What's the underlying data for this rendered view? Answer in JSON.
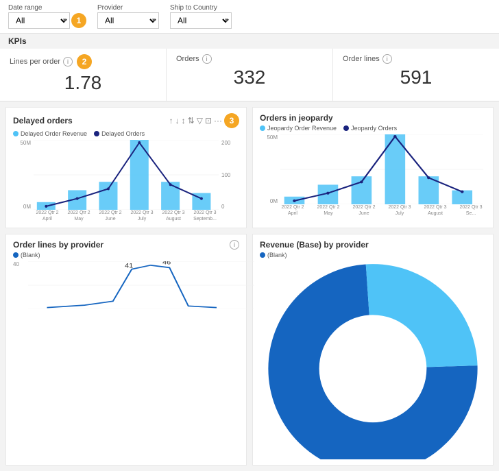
{
  "filters": {
    "date_range": {
      "label": "Date range",
      "value": "All"
    },
    "provider": {
      "label": "Provider",
      "value": "All"
    },
    "ship_to_country": {
      "label": "Ship to Country",
      "value": "All"
    }
  },
  "steps": [
    "1",
    "2",
    "3"
  ],
  "kpis_label": "KPIs",
  "kpis": [
    {
      "title": "Lines per order",
      "value": "1.78"
    },
    {
      "title": "Orders",
      "value": "332"
    },
    {
      "title": "Order lines",
      "value": "591"
    }
  ],
  "charts": [
    {
      "title": "Delayed orders",
      "legend": [
        {
          "label": "Delayed Order Revenue",
          "color": "#4fc3f7"
        },
        {
          "label": "Delayed Orders",
          "color": "#1a237e"
        }
      ],
      "x_labels": [
        "2022 Qtr 2\nApril",
        "2022 Qtr 2\nMay",
        "2022 Qtr 2\nJune",
        "2022 Qtr 3\nJuly",
        "2022 Qtr 3\nAugust",
        "2022 Qtr 3\nSeptemb..."
      ],
      "y_left_labels": [
        "50M",
        "0M"
      ],
      "y_right_labels": [
        "200",
        "100",
        "0"
      ],
      "bars": [
        5,
        15,
        20,
        55,
        20,
        12
      ],
      "line": [
        2,
        8,
        15,
        50,
        18,
        8
      ]
    },
    {
      "title": "Orders in jeopardy",
      "legend": [
        {
          "label": "Jeopardy Order Revenue",
          "color": "#4fc3f7"
        },
        {
          "label": "Jeopardy Orders",
          "color": "#1a237e"
        }
      ],
      "x_labels": [
        "2022 Qtr 2\nApril",
        "2022 Qtr 2\nMay",
        "2022 Qtr 2\nJune",
        "2022 Qtr 3\nJuly",
        "2022 Qtr 3\nAugust",
        "2022 Qtr 3\nSe..."
      ],
      "y_left_labels": [
        "50M",
        "0M"
      ],
      "bars": [
        5,
        15,
        20,
        55,
        20,
        10
      ],
      "line": [
        2,
        8,
        15,
        52,
        18,
        8
      ]
    }
  ],
  "bottom_charts": [
    {
      "title": "Order lines by provider",
      "legend": [
        {
          "label": "(Blank)",
          "color": "#1565c0"
        }
      ],
      "values": [
        "41",
        "46"
      ],
      "y_label": "40",
      "info": true
    },
    {
      "title": "Revenue (Base) by provider",
      "legend": [
        {
          "label": "(Blank)",
          "color": "#1565c0"
        }
      ],
      "info": false
    }
  ],
  "toolbar": {
    "sort_asc": "↑",
    "sort_desc": "↓",
    "sort_both": "↕",
    "hierarchy": "⇅",
    "filter": "⚗",
    "expand": "⊡",
    "more": "···"
  }
}
